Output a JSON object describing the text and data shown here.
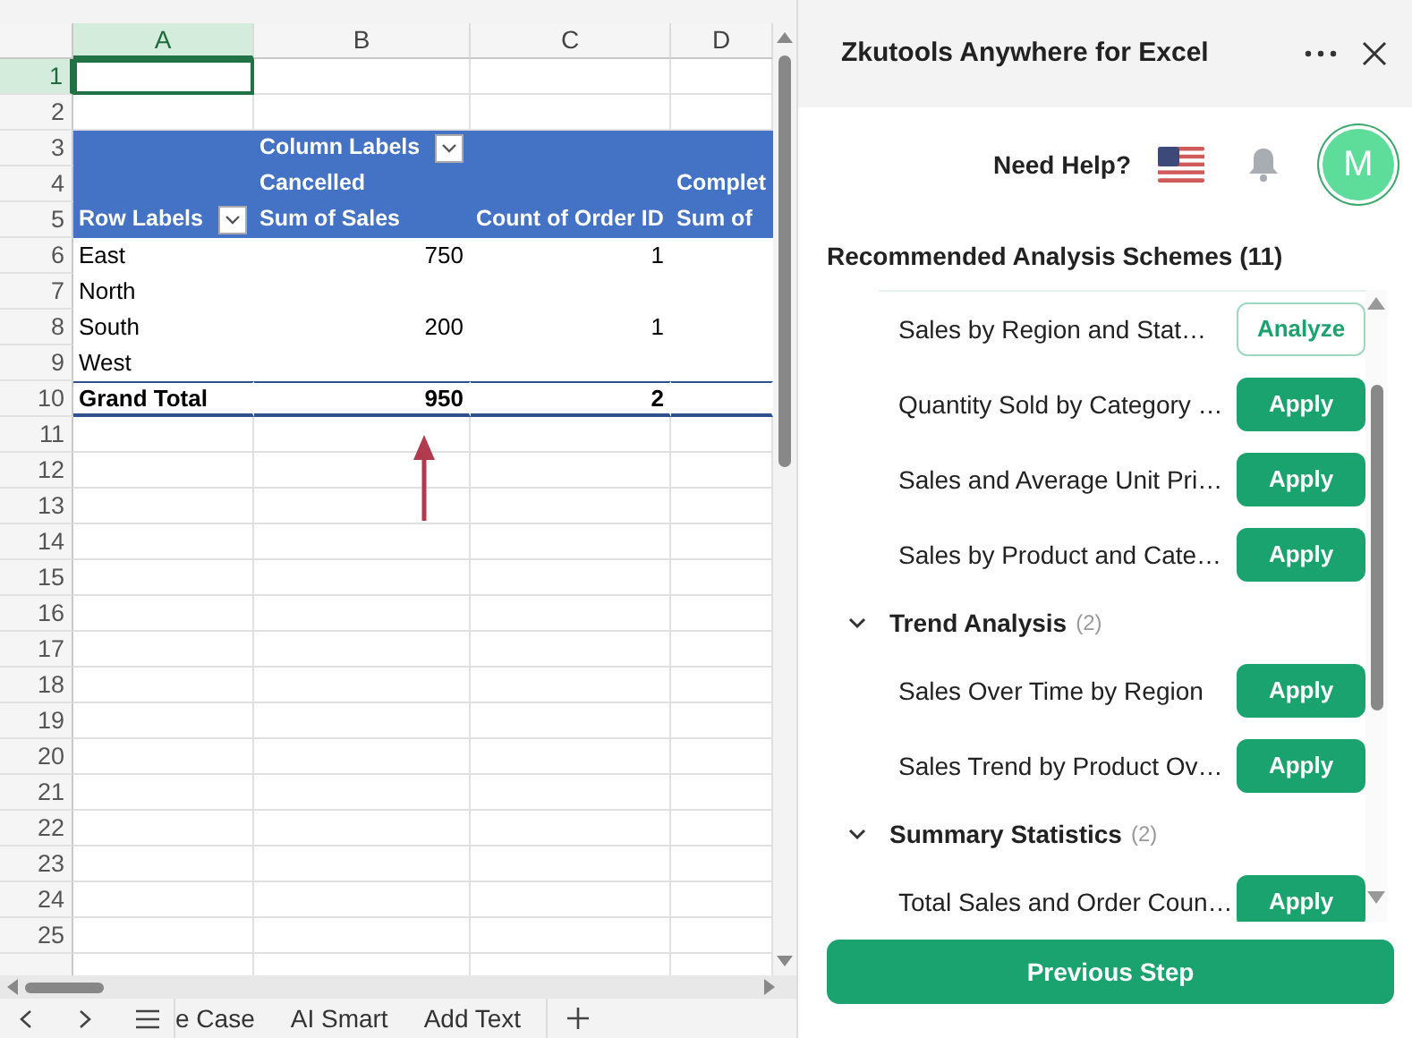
{
  "sheet": {
    "columns": [
      {
        "label": "A",
        "selected": true
      },
      {
        "label": "B",
        "selected": false
      },
      {
        "label": "C",
        "selected": false
      },
      {
        "label": "D",
        "selected": false
      }
    ],
    "rows": [
      {
        "number": "1",
        "selected": true,
        "kind": "blank",
        "cells": [
          {
            "active": true
          },
          {},
          {},
          {}
        ]
      },
      {
        "number": "2",
        "selected": false,
        "kind": "blank",
        "cells": [
          {},
          {},
          {},
          {}
        ]
      },
      {
        "number": "3",
        "selected": false,
        "kind": "header",
        "cells": [
          {},
          {
            "text": "Column Labels",
            "filter": true
          },
          {},
          {}
        ]
      },
      {
        "number": "4",
        "selected": false,
        "kind": "header",
        "cells": [
          {},
          {
            "text": "Cancelled"
          },
          {},
          {
            "text": "Complet"
          }
        ]
      },
      {
        "number": "5",
        "selected": false,
        "kind": "header",
        "cells": [
          {
            "text": "Row Labels",
            "filter": true
          },
          {
            "text": "Sum of Sales"
          },
          {
            "text": "Count of Order ID"
          },
          {
            "text": "Sum of"
          }
        ]
      },
      {
        "number": "6",
        "selected": false,
        "kind": "data",
        "cells": [
          {
            "text": "East"
          },
          {
            "text": "750",
            "kind": "number"
          },
          {
            "text": "1",
            "kind": "number"
          },
          {}
        ]
      },
      {
        "number": "7",
        "selected": false,
        "kind": "data",
        "cells": [
          {
            "text": "North"
          },
          {},
          {},
          {}
        ]
      },
      {
        "number": "8",
        "selected": false,
        "kind": "data",
        "cells": [
          {
            "text": "South"
          },
          {
            "text": "200",
            "kind": "number"
          },
          {
            "text": "1",
            "kind": "number"
          },
          {}
        ]
      },
      {
        "number": "9",
        "selected": false,
        "kind": "data",
        "cells": [
          {
            "text": "West"
          },
          {},
          {},
          {}
        ]
      },
      {
        "number": "10",
        "selected": false,
        "kind": "total",
        "cells": [
          {
            "text": "Grand Total"
          },
          {
            "text": "950",
            "kind": "number"
          },
          {
            "text": "2",
            "kind": "number"
          },
          {}
        ]
      },
      {
        "number": "11",
        "selected": false,
        "kind": "blank",
        "cells": [
          {},
          {},
          {},
          {}
        ]
      },
      {
        "number": "12",
        "selected": false,
        "kind": "blank",
        "cells": [
          {},
          {},
          {},
          {}
        ]
      },
      {
        "number": "13",
        "selected": false,
        "kind": "blank",
        "cells": [
          {},
          {},
          {},
          {}
        ]
      },
      {
        "number": "14",
        "selected": false,
        "kind": "blank",
        "cells": [
          {},
          {},
          {},
          {}
        ]
      },
      {
        "number": "15",
        "selected": false,
        "kind": "blank",
        "cells": [
          {},
          {},
          {},
          {}
        ]
      },
      {
        "number": "16",
        "selected": false,
        "kind": "blank",
        "cells": [
          {},
          {},
          {},
          {}
        ]
      },
      {
        "number": "17",
        "selected": false,
        "kind": "blank",
        "cells": [
          {},
          {},
          {},
          {}
        ]
      },
      {
        "number": "18",
        "selected": false,
        "kind": "blank",
        "cells": [
          {},
          {},
          {},
          {}
        ]
      },
      {
        "number": "19",
        "selected": false,
        "kind": "blank",
        "cells": [
          {},
          {},
          {},
          {}
        ]
      },
      {
        "number": "20",
        "selected": false,
        "kind": "blank",
        "cells": [
          {},
          {},
          {},
          {}
        ]
      },
      {
        "number": "21",
        "selected": false,
        "kind": "blank",
        "cells": [
          {},
          {},
          {},
          {}
        ]
      },
      {
        "number": "22",
        "selected": false,
        "kind": "blank",
        "cells": [
          {},
          {},
          {},
          {}
        ]
      },
      {
        "number": "23",
        "selected": false,
        "kind": "blank",
        "cells": [
          {},
          {},
          {},
          {}
        ]
      },
      {
        "number": "24",
        "selected": false,
        "kind": "blank",
        "cells": [
          {},
          {},
          {},
          {}
        ]
      },
      {
        "number": "25",
        "selected": false,
        "kind": "blank",
        "cells": [
          {},
          {},
          {},
          {}
        ]
      }
    ],
    "sheet_tabs": [
      {
        "label": "e Case"
      },
      {
        "label": "AI Smart"
      },
      {
        "label": "Add Text"
      }
    ]
  },
  "panel": {
    "title": "Zkutools Anywhere for Excel",
    "help_label": "Need Help?",
    "avatar_initial": "M",
    "section_title": "Recommended Analysis Schemes (11)",
    "items": [
      {
        "kind": "scheme",
        "label": "Sales by Region and Stat…",
        "button": "Analyze",
        "outlined": true
      },
      {
        "kind": "scheme",
        "label": "Quantity Sold by Category …",
        "button": "Apply",
        "outlined": false
      },
      {
        "kind": "scheme",
        "label": "Sales and Average Unit Pri…",
        "button": "Apply",
        "outlined": false
      },
      {
        "kind": "scheme",
        "label": "Sales by Product and Cate…",
        "button": "Apply",
        "outlined": false
      },
      {
        "kind": "group",
        "label": "Trend Analysis",
        "count": "(2)",
        "expanded": true
      },
      {
        "kind": "scheme",
        "label": "Sales Over Time by Region",
        "button": "Apply",
        "outlined": false
      },
      {
        "kind": "scheme",
        "label": "Sales Trend by Product Ov…",
        "button": "Apply",
        "outlined": false
      },
      {
        "kind": "group",
        "label": "Summary Statistics",
        "count": "(2)",
        "expanded": true
      },
      {
        "kind": "scheme",
        "label": "Total Sales and Order Coun…",
        "button": "Apply",
        "outlined": false
      }
    ],
    "primary_button": "Previous Step"
  }
}
